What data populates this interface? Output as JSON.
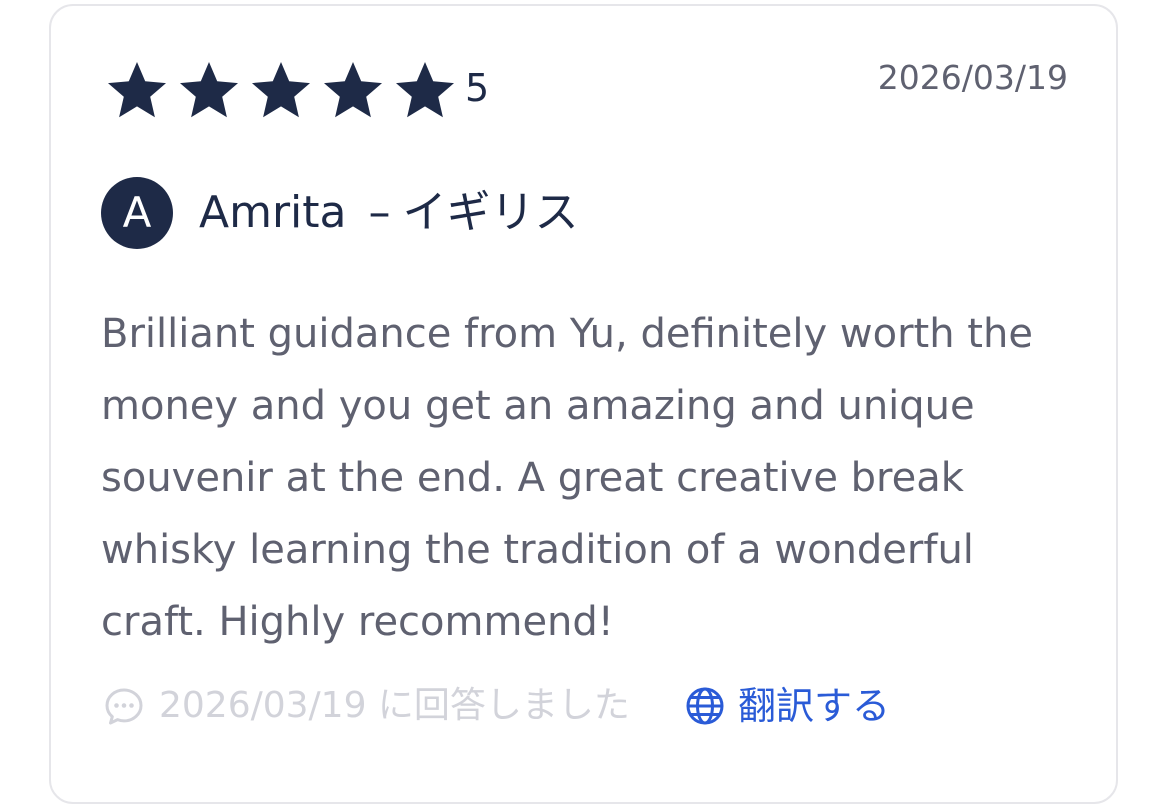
{
  "review": {
    "rating": {
      "stars_filled": 5,
      "stars_total": 5,
      "value_label": "5",
      "star_color": "#1e2a47",
      "star_icon": "star-icon"
    },
    "date": "2026/03/19",
    "author": {
      "initial": "A",
      "name": "Amrita",
      "separator": "–",
      "country": "イギリス",
      "avatar_color": "#1e2a47"
    },
    "body": "Brilliant guidance from Yu, definitely worth the money and you get an amazing and unique souvenir at the end. A great creative break whisky learning the tradition of a wonderful craft. Highly recommend!",
    "reply": {
      "icon": "comment-icon",
      "text": "2026/03/19 に回答しました",
      "color": "#d2d3da"
    },
    "translate": {
      "icon": "globe-icon",
      "label": "翻訳する",
      "color": "#2a5bd7"
    }
  }
}
